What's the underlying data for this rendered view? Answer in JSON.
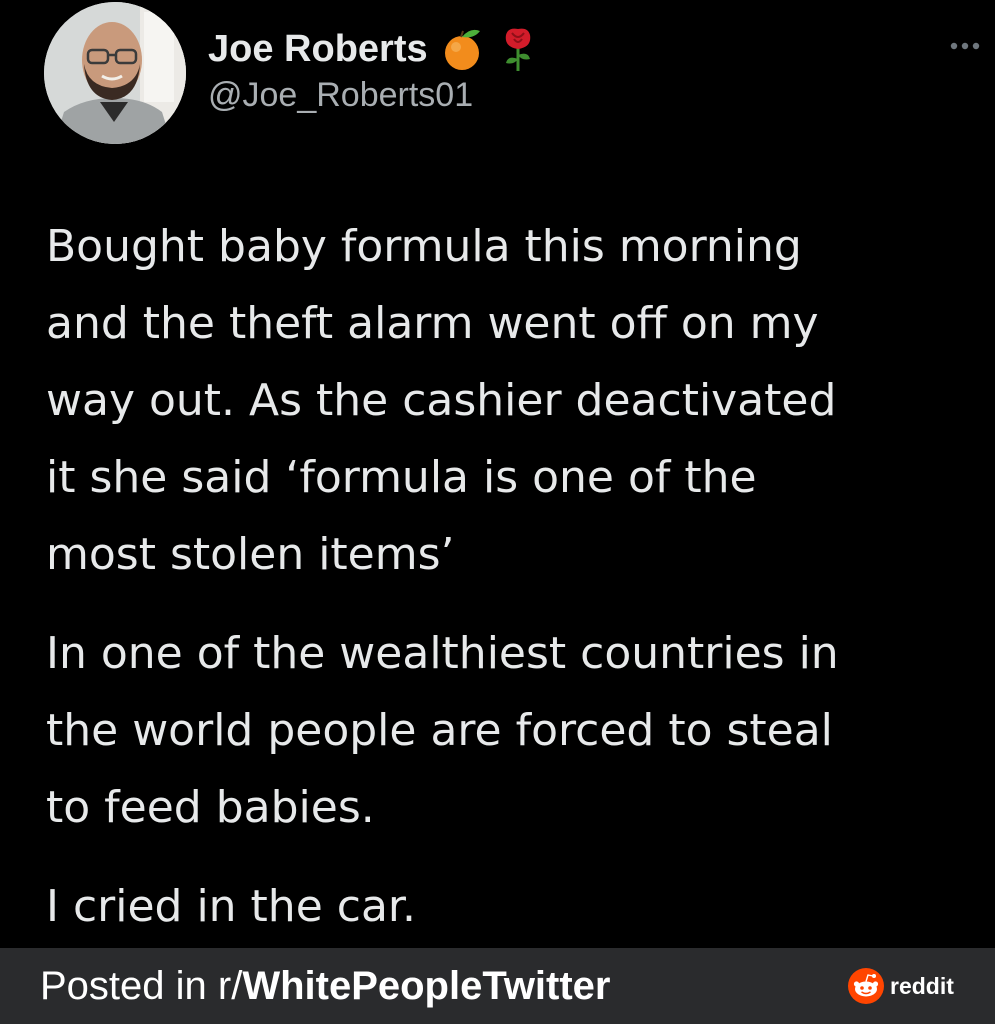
{
  "tweet": {
    "display_name": "Joe Roberts",
    "handle": "@Joe_Roberts01",
    "name_emojis": [
      "orange-emoji",
      "rose-emoji"
    ],
    "paragraphs": [
      "Bought baby formula this morning\nand the theft alarm went off on my\nway out. As the cashier deactivated\nit she said ‘formula is one of the\nmost stolen items’",
      "In one of the wealthiest countries in\nthe world people are forced to steal\nto feed babies.",
      "I cried in the car."
    ]
  },
  "footer": {
    "posted_prefix": "Posted in r/",
    "subreddit": "WhitePeopleTwitter",
    "brand": "reddit"
  },
  "colors": {
    "background": "#000000",
    "text": "#e7e9ea",
    "secondary_text": "#a9aeb2",
    "footer_bg": "#2a2b2d",
    "reddit_orange": "#ff4500"
  }
}
